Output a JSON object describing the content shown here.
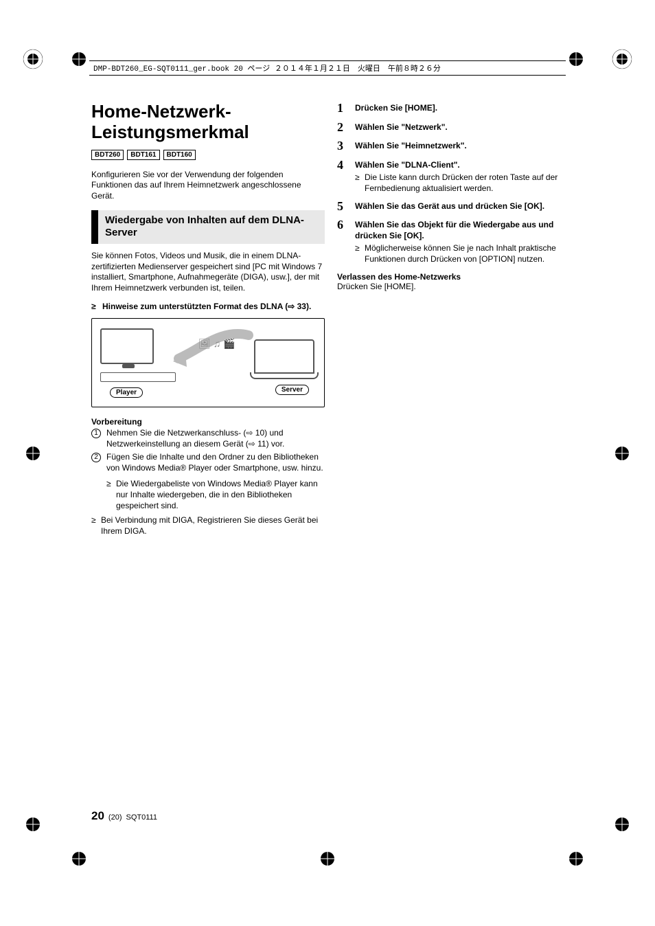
{
  "header": {
    "runner": "DMP-BDT260_EG-SQT0111_ger.book  20 ページ  ２０１４年１月２１日　火曜日　午前８時２６分"
  },
  "left": {
    "title": "Home-Netzwerk-Leistungsmerkmal",
    "badges": [
      "BDT260",
      "BDT161",
      "BDT160"
    ],
    "intro": "Konfigurieren Sie vor der Verwendung der folgenden Funktionen das auf Ihrem Heimnetzwerk angeschlossene Gerät.",
    "section": "Wiedergabe von Inhalten auf dem DLNA-Server",
    "para1": "Sie können Fotos, Videos und Musik, die in einem DLNA-zertifizierten Medienserver gespeichert sind [PC mit Windows 7 installiert, Smartphone, Aufnahmegeräte (DIGA), usw.], der mit Ihrem Heimnetzwerk verbunden ist, teilen.",
    "hint": "Hinweise zum unterstützten Format des DLNA (⇨ 33).",
    "diagram": {
      "player": "Player",
      "server": "Server"
    },
    "prep_head": "Vorbereitung",
    "prep": [
      "Nehmen Sie die Netzwerkanschluss- (⇨ 10) und Netzwerkeinstellung an diesem Gerät (⇨ 11) vor.",
      "Fügen Sie die Inhalte und den Ordner zu den Bibliotheken von Windows Media® Player oder Smartphone, usw. hinzu."
    ],
    "prep_sub": "Die Wiedergabeliste von Windows Media® Player kann nur Inhalte wiedergeben, die in den Bibliotheken gespeichert sind.",
    "diga_note": "Bei Verbindung mit DIGA, Registrieren Sie dieses Gerät bei Ihrem DIGA."
  },
  "right": {
    "steps": [
      {
        "n": "1",
        "bold": "Drücken Sie [HOME]."
      },
      {
        "n": "2",
        "bold": "Wählen Sie \"Netzwerk\"."
      },
      {
        "n": "3",
        "bold": "Wählen Sie \"Heimnetzwerk\"."
      },
      {
        "n": "4",
        "bold": "Wählen Sie \"DLNA-Client\".",
        "sub": "Die Liste kann durch Drücken der roten Taste auf der Fernbedienung aktualisiert werden."
      },
      {
        "n": "5",
        "bold": "Wählen Sie das Gerät aus und drücken Sie [OK]."
      },
      {
        "n": "6",
        "bold": "Wählen Sie das Objekt für die Wiedergabe aus und drücken Sie [OK].",
        "sub": "Möglicherweise können Sie je nach Inhalt praktische Funktionen durch Drücken von [OPTION] nutzen."
      }
    ],
    "exit_head": "Verlassen des Home-Netzwerks",
    "exit_body": "Drücken Sie [HOME]."
  },
  "footer": {
    "page": "20",
    "sub": "(20)",
    "code": "SQT0111"
  }
}
